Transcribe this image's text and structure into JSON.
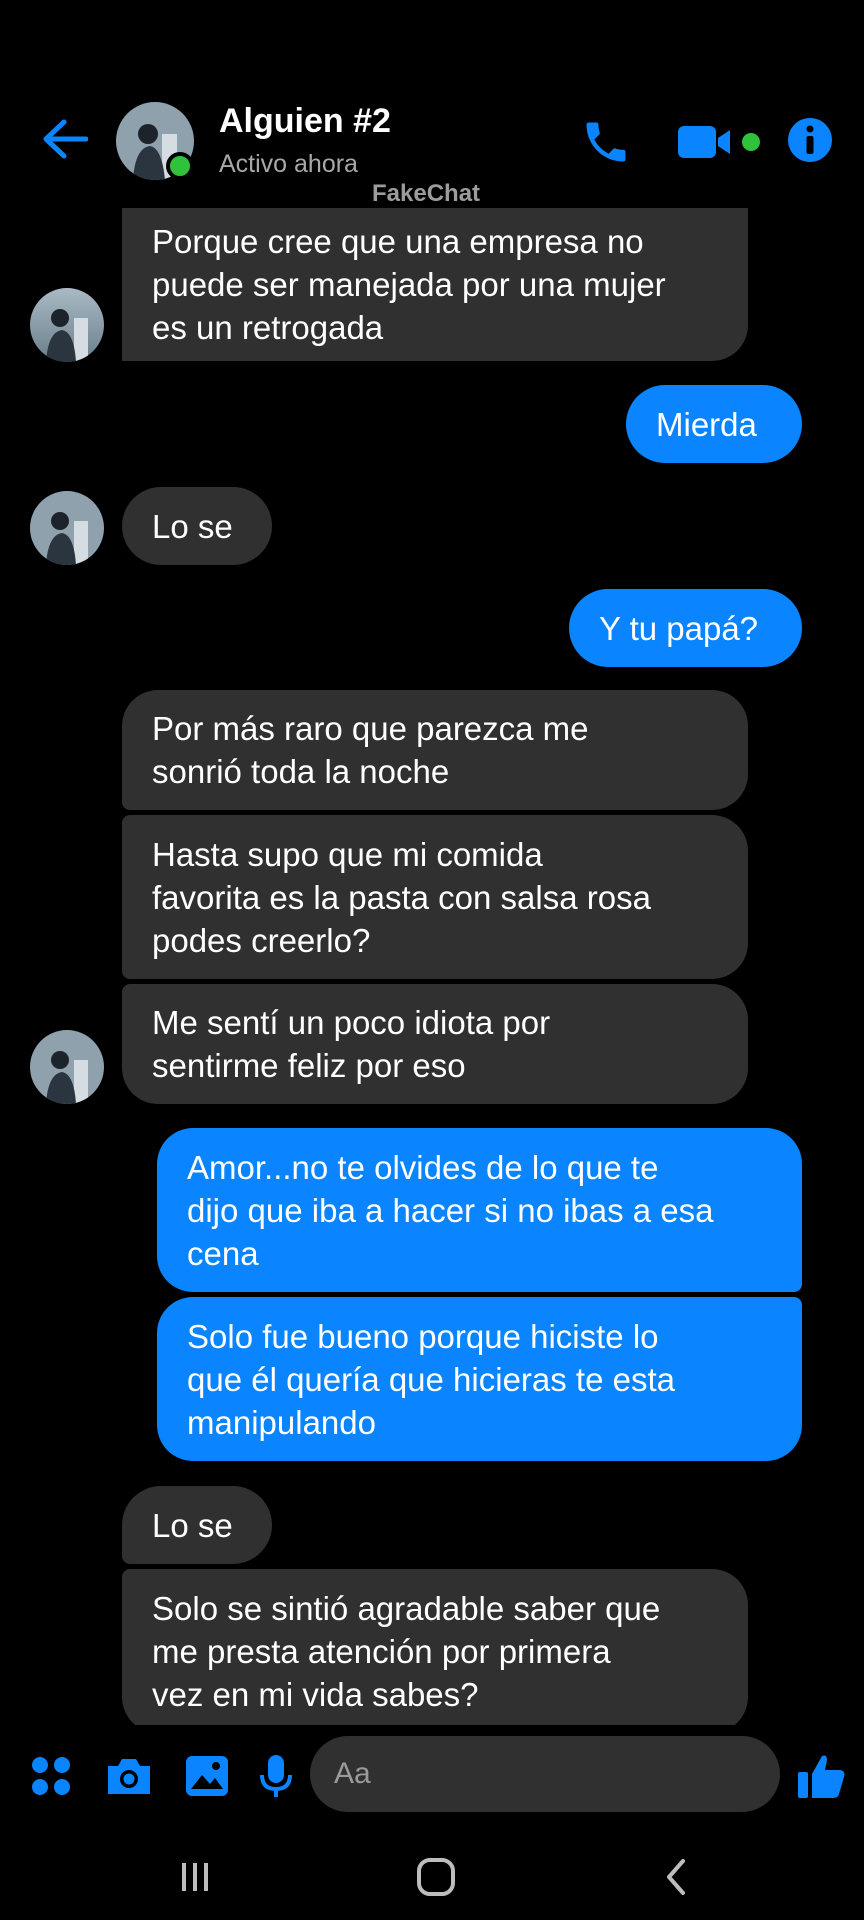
{
  "header": {
    "contact_name": "Alguien #2",
    "status": "Activo ahora",
    "watermark": "FakeChat"
  },
  "colors": {
    "accent": "#0a84ff",
    "incoming_bubble": "#303030",
    "online": "#31c23b",
    "background": "#000000"
  },
  "icons": {
    "back": "arrow-left-icon",
    "call": "phone-icon",
    "video": "video-camera-icon",
    "info": "info-icon",
    "menu": "four-dots-icon",
    "camera": "camera-icon",
    "gallery": "image-icon",
    "mic": "microphone-icon",
    "emoji": "smiley-icon",
    "like": "thumbs-up-icon"
  },
  "messages": [
    {
      "direction": "in",
      "lines": [
        "Porque cree que una empresa no",
        "puede ser manejada por una mujer",
        "es un retrogada"
      ]
    },
    {
      "direction": "out",
      "lines": [
        "Mierda"
      ]
    },
    {
      "direction": "in",
      "lines": [
        "Lo se"
      ]
    },
    {
      "direction": "out",
      "lines": [
        "Y tu papá?"
      ]
    },
    {
      "direction": "in",
      "lines": [
        "Por más raro que parezca me",
        "sonrió toda la noche"
      ]
    },
    {
      "direction": "in",
      "lines": [
        "Hasta supo que mi comida",
        "favorita es la pasta con salsa rosa",
        "podes creerlo?"
      ]
    },
    {
      "direction": "in",
      "lines": [
        "Me sentí un poco idiota por",
        "sentirme feliz por eso"
      ]
    },
    {
      "direction": "out",
      "lines": [
        "Amor...no te olvides de lo que te",
        "dijo que iba a hacer si no ibas a esa",
        "cena"
      ]
    },
    {
      "direction": "out",
      "lines": [
        "Solo fue bueno porque hiciste lo",
        "que él quería que hicieras te esta",
        "manipulando"
      ]
    },
    {
      "direction": "in",
      "lines": [
        "Lo se"
      ]
    },
    {
      "direction": "in",
      "lines": [
        "Solo se sintió agradable saber que",
        "me presta atención por primera",
        "vez en mi vida sabes?"
      ]
    }
  ],
  "composer": {
    "placeholder": "Aa"
  }
}
